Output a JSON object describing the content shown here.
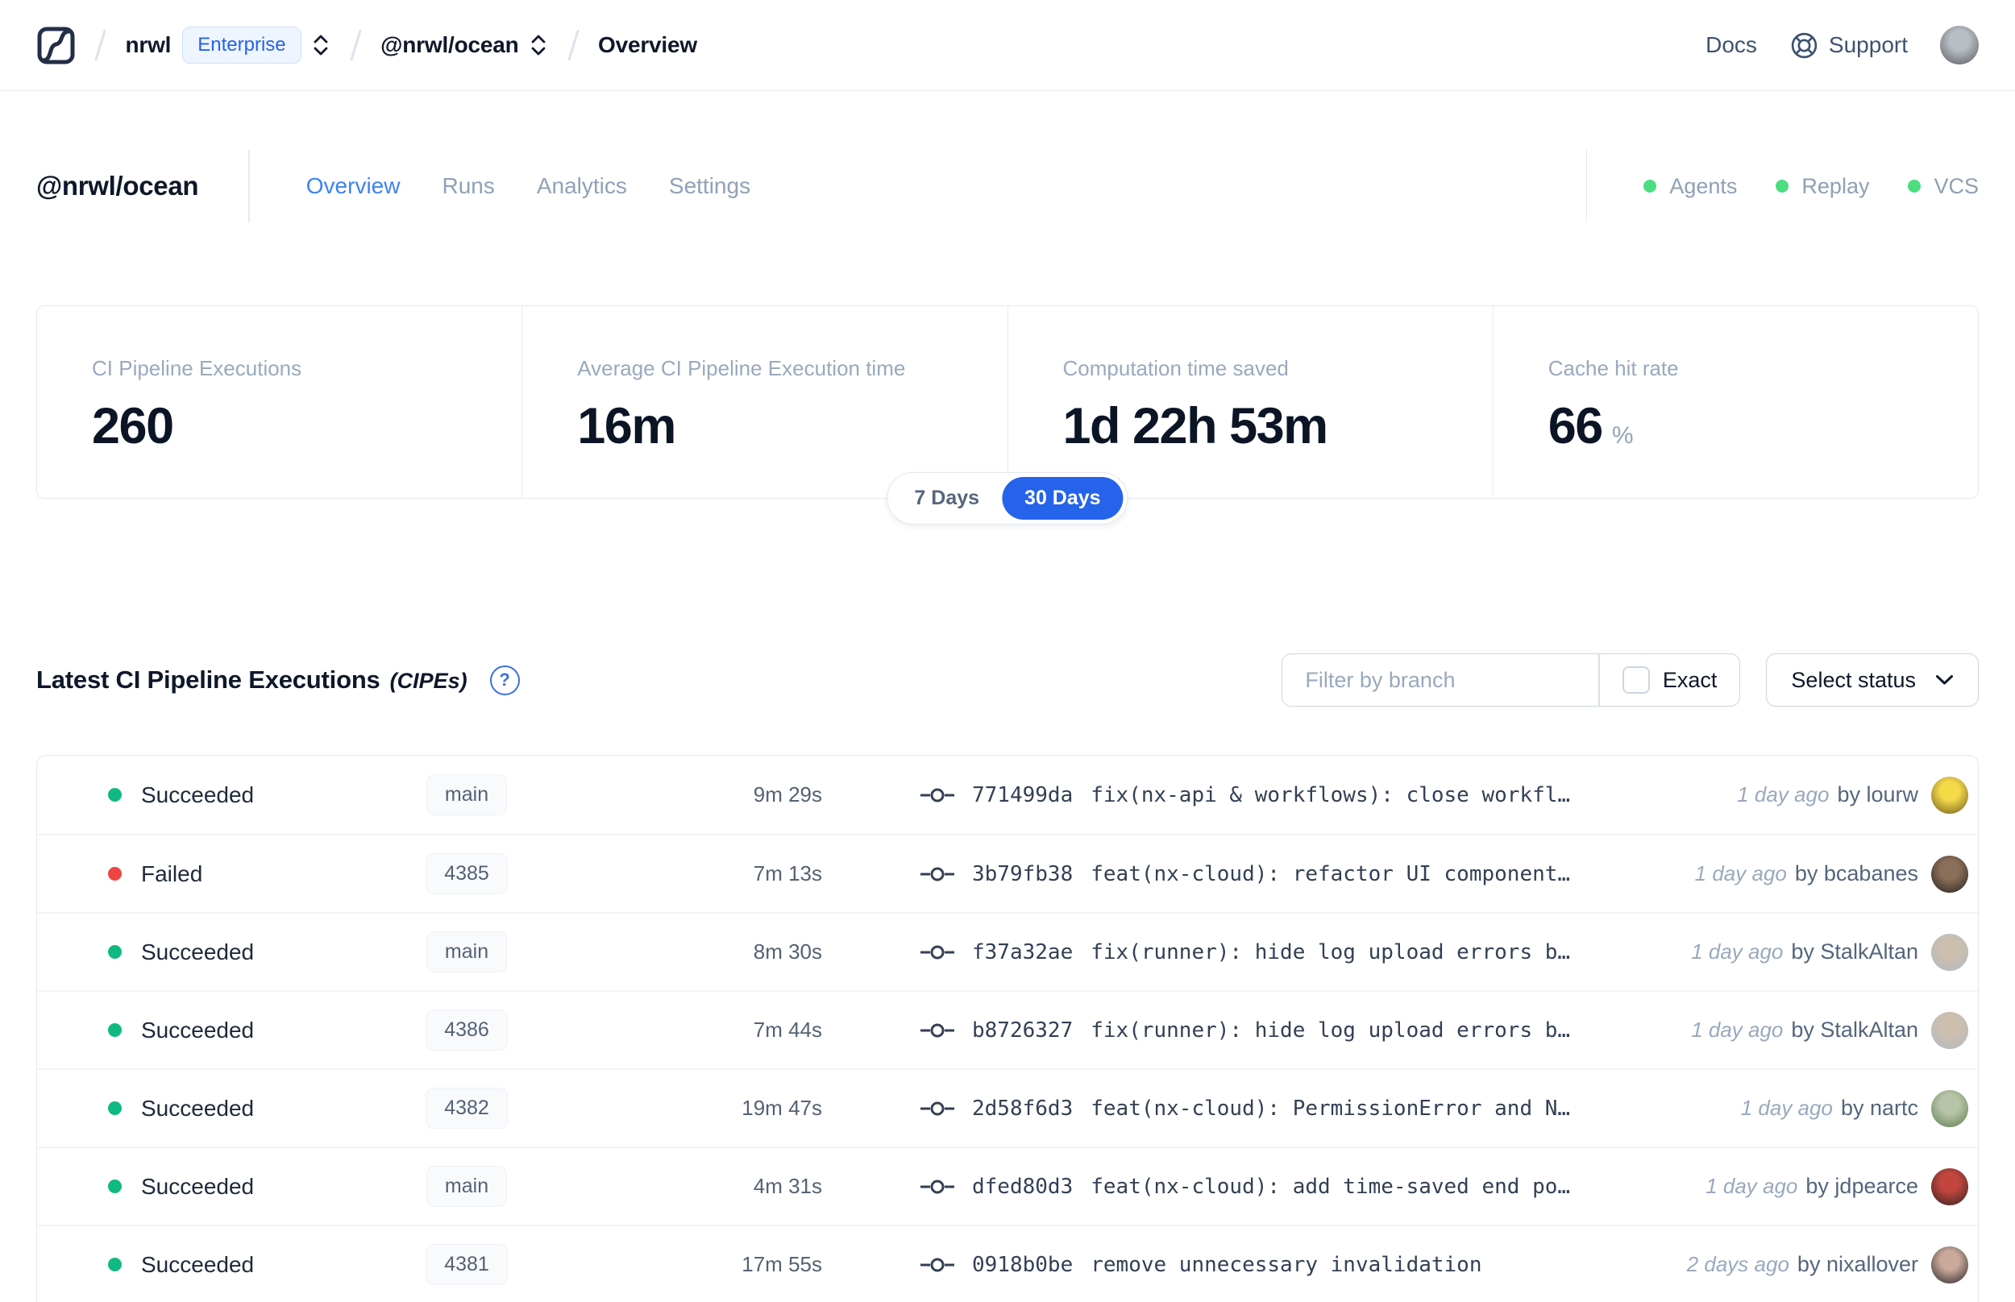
{
  "navbar": {
    "org": "nrwl",
    "org_badge": "Enterprise",
    "workspace": "@nrwl/ocean",
    "page": "Overview",
    "docs_label": "Docs",
    "support_label": "Support",
    "avatar": {
      "inner": "#b9bdc4",
      "outer": "#55595f"
    }
  },
  "header": {
    "title": "@nrwl/ocean",
    "tabs": [
      {
        "label": "Overview",
        "active": true
      },
      {
        "label": "Runs",
        "active": false
      },
      {
        "label": "Analytics",
        "active": false
      },
      {
        "label": "Settings",
        "active": false
      }
    ],
    "features": [
      {
        "label": "Agents"
      },
      {
        "label": "Replay"
      },
      {
        "label": "VCS"
      }
    ]
  },
  "stats": {
    "cards": [
      {
        "label": "CI Pipeline Executions",
        "value": "260",
        "suffix": ""
      },
      {
        "label": "Average CI Pipeline Execution time",
        "value": "16m",
        "suffix": ""
      },
      {
        "label": "Computation time saved",
        "value": "1d 22h 53m",
        "suffix": ""
      },
      {
        "label": "Cache hit rate",
        "value": "66",
        "suffix": "%"
      }
    ],
    "range_toggle": {
      "options": [
        "7 Days",
        "30 Days"
      ],
      "selected": "30 Days"
    }
  },
  "cipes": {
    "title": "Latest CI Pipeline Executions",
    "title_suffix": "(CIPEs)",
    "filter_placeholder": "Filter by branch",
    "exact_label": "Exact",
    "status_label": "Select status",
    "rows": [
      {
        "status": "Succeeded",
        "status_color": "#10b981",
        "branch": "main",
        "duration": "9m 29s",
        "hash": "771499da",
        "message": "fix(nx-api & workflows): close workfl…",
        "time": "1 day ago",
        "author": "by lourw",
        "avatar": {
          "inner": "#f5d949",
          "outer": "#6b5a1e"
        }
      },
      {
        "status": "Failed",
        "status_color": "#ef4444",
        "branch": "4385",
        "duration": "7m 13s",
        "hash": "3b79fb38",
        "message": "feat(nx-cloud): refactor UI component…",
        "time": "1 day ago",
        "author": "by bcabanes",
        "avatar": {
          "inner": "#8a6f5a",
          "outer": "#26211e"
        }
      },
      {
        "status": "Succeeded",
        "status_color": "#10b981",
        "branch": "main",
        "duration": "8m 30s",
        "hash": "f37a32ae",
        "message": "fix(runner): hide log upload errors b…",
        "time": "1 day ago",
        "author": "by StalkAltan",
        "avatar": {
          "inner": "#cdbfae",
          "outer": "#aeb9c4"
        }
      },
      {
        "status": "Succeeded",
        "status_color": "#10b981",
        "branch": "4386",
        "duration": "7m 44s",
        "hash": "b8726327",
        "message": "fix(runner): hide log upload errors b…",
        "time": "1 day ago",
        "author": "by StalkAltan",
        "avatar": {
          "inner": "#cdbfae",
          "outer": "#aeb9c4"
        }
      },
      {
        "status": "Succeeded",
        "status_color": "#10b981",
        "branch": "4382",
        "duration": "19m 47s",
        "hash": "2d58f6d3",
        "message": "feat(nx-cloud): PermissionError and N…",
        "time": "1 day ago",
        "author": "by nartc",
        "avatar": {
          "inner": "#b8c4a8",
          "outer": "#5c7d52"
        }
      },
      {
        "status": "Succeeded",
        "status_color": "#10b981",
        "branch": "main",
        "duration": "4m 31s",
        "hash": "dfed80d3",
        "message": "feat(nx-cloud): add time-saved end po…",
        "time": "1 day ago",
        "author": "by jdpearce",
        "avatar": {
          "inner": "#c2453e",
          "outer": "#2e2420"
        }
      },
      {
        "status": "Succeeded",
        "status_color": "#10b981",
        "branch": "4381",
        "duration": "17m 55s",
        "hash": "0918b0be",
        "message": "remove unnecessary invalidation",
        "time": "2 days ago",
        "author": "by nixallover",
        "avatar": {
          "inner": "#caa99a",
          "outer": "#242428"
        }
      }
    ]
  },
  "colors": {
    "accent_blue": "#2563eb",
    "tab_active_blue": "#3b82f6",
    "success_green": "#10b981",
    "failed_red": "#ef4444",
    "feature_dot_green": "#4ade80",
    "muted_text": "#94a3b8",
    "border": "#e2e8f0"
  }
}
